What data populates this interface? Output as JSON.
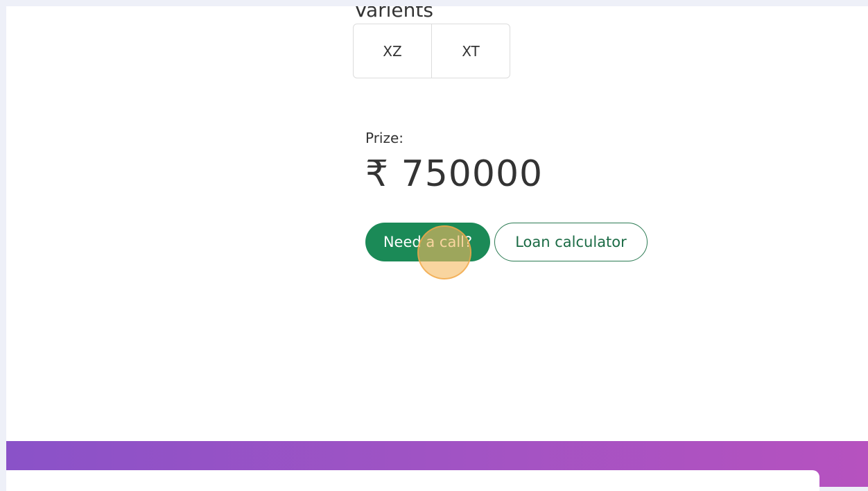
{
  "variants": {
    "heading": "Varients",
    "options": [
      "XZ",
      "XT"
    ]
  },
  "price": {
    "label": "Prize:",
    "value": "₹ 750000"
  },
  "actions": {
    "call_label": "Need a call?",
    "loan_label": "Loan calculator"
  },
  "colors": {
    "primary_green": "#1b8a57",
    "band_gradient_start": "#8a52c8",
    "band_gradient_end": "#b652bf"
  }
}
